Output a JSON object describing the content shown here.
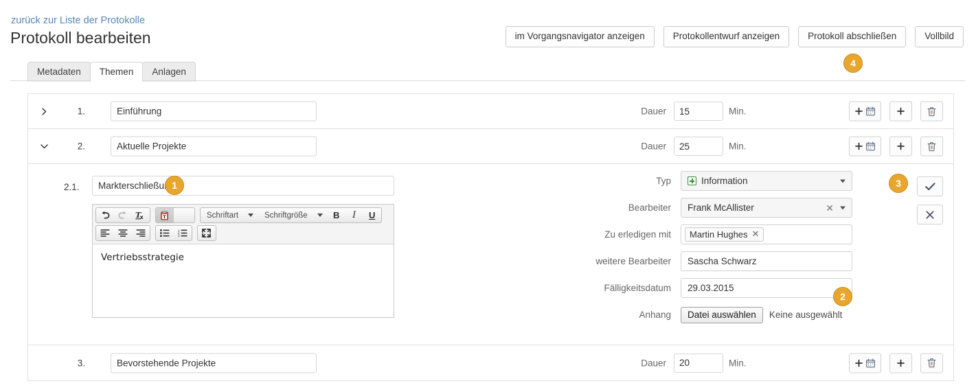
{
  "header": {
    "back_link": "zurück zur Liste der Protokolle",
    "title": "Protokoll bearbeiten",
    "buttons": [
      {
        "label": "im Vorgangsnavigator anzeigen",
        "name": "show-in-process-navigator-button"
      },
      {
        "label": "Protokollentwurf anzeigen",
        "name": "show-minutes-draft-button"
      },
      {
        "label": "Protokoll abschließen",
        "name": "finish-minutes-button"
      },
      {
        "label": "Vollbild",
        "name": "fullscreen-button"
      }
    ]
  },
  "tabs": [
    {
      "label": "Metadaten",
      "active": false
    },
    {
      "label": "Themen",
      "active": true
    },
    {
      "label": "Anlagen",
      "active": false
    }
  ],
  "topics": [
    {
      "number": "1.",
      "title": "Einführung",
      "duration": "15",
      "duration_label": "Dauer",
      "unit_label": "Min.",
      "expanded": false,
      "chevron": "chevron-right"
    },
    {
      "number": "2.",
      "title": "Aktuelle Projekte",
      "duration": "25",
      "duration_label": "Dauer",
      "unit_label": "Min.",
      "expanded": true,
      "chevron": "chevron-down"
    },
    {
      "number": "3.",
      "title": "Bevorstehende Projekte",
      "duration": "20",
      "duration_label": "Dauer",
      "unit_label": "Min.",
      "expanded": false,
      "chevron": "none"
    }
  ],
  "subtopic": {
    "number": "2.1.",
    "title": "Markterschließung",
    "editor": {
      "toolbar": {
        "undo": "undo-icon",
        "redo": "redo-icon",
        "remove_format": "remove-format-icon",
        "paste_text": "paste-as-text-icon",
        "font_family_label": "Schriftart",
        "font_size_label": "Schriftgröße",
        "bold": "B",
        "italic": "I",
        "underline": "U",
        "align_left": "align-left-icon",
        "align_center": "align-center-icon",
        "align_right": "align-right-icon",
        "bullet_list": "bullet-list-icon",
        "numbered_list": "numbered-list-icon",
        "maximize": "maximize-icon"
      },
      "content": "Vertriebsstrategie"
    },
    "fields": {
      "typ": {
        "label": "Typ",
        "value": "Information",
        "icon": "green-plus-icon"
      },
      "bearbeiter": {
        "label": "Bearbeiter",
        "value": "Frank McAllister"
      },
      "zu_erledigen_mit": {
        "label": "Zu erledigen mit",
        "value": "Martin Hughes"
      },
      "weitere_bearbeiter": {
        "label": "weitere Bearbeiter",
        "value": "Sascha Schwarz"
      },
      "faelligkeitsdatum": {
        "label": "Fälligkeitsdatum",
        "value": "29.03.2015"
      },
      "anhang": {
        "label": "Anhang",
        "button": "Datei auswählen",
        "status": "Keine ausgewählt"
      }
    },
    "actions": {
      "confirm": "check-icon",
      "cancel": "close-icon"
    }
  },
  "row_actions": {
    "add_with_date": "plus-calendar-icon",
    "add": "plus-icon",
    "delete": "trash-icon"
  },
  "badges": [
    {
      "id": "1",
      "label": "1"
    },
    {
      "id": "2",
      "label": "2"
    },
    {
      "id": "3",
      "label": "3"
    },
    {
      "id": "4",
      "label": "4"
    }
  ],
  "colors": {
    "badge_fill": "#e8a72c",
    "badge_border": "#c98a1c",
    "link": "#5b86b5",
    "green_plus": "#3e8f3e",
    "border": "#e0e0e0"
  }
}
